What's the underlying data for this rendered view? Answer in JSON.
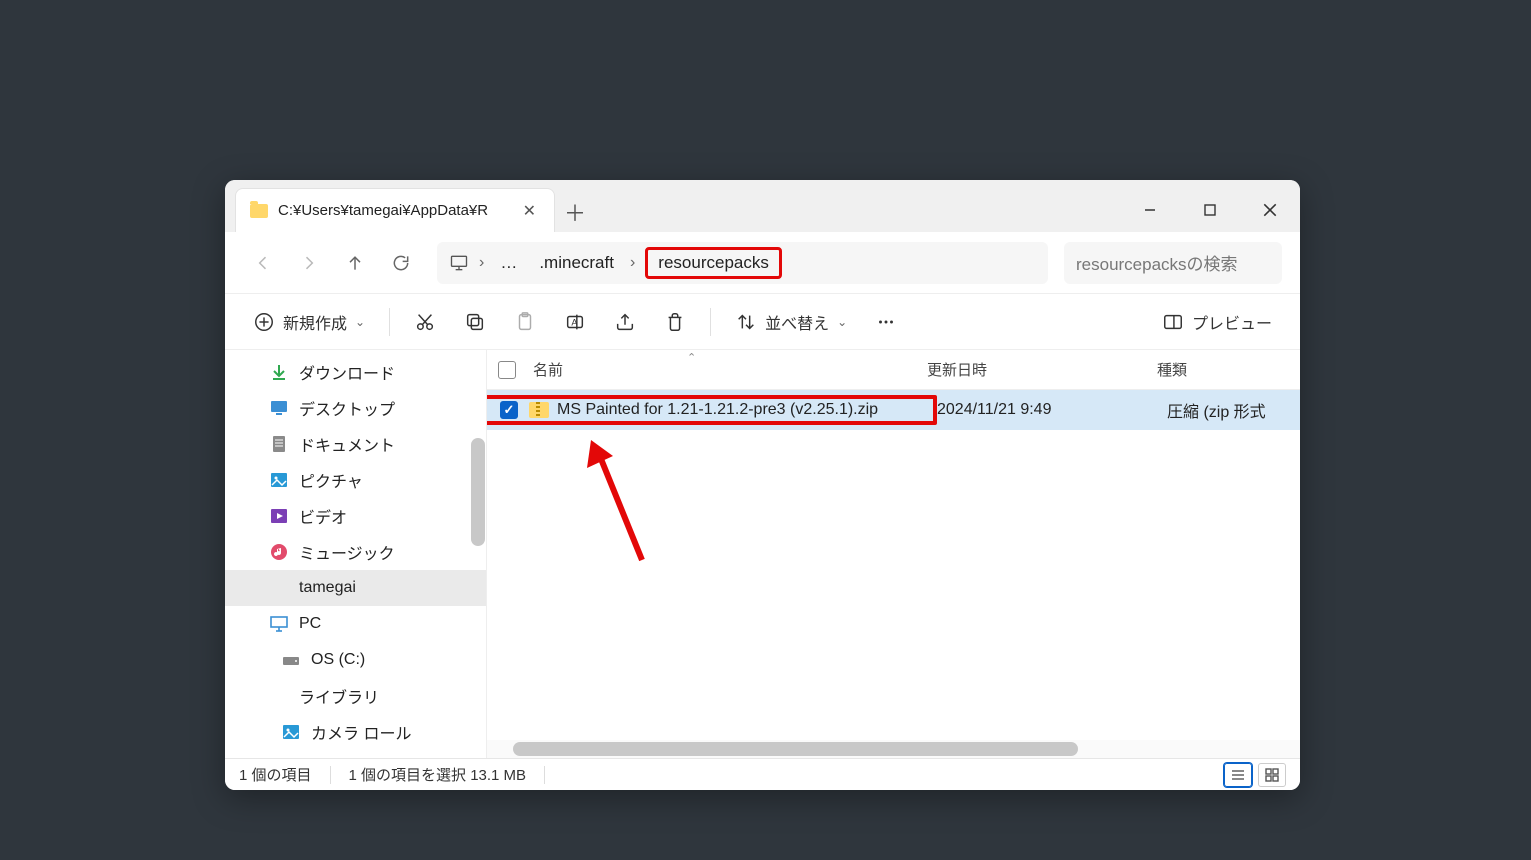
{
  "tab": {
    "title": "C:¥Users¥tamegai¥AppData¥R"
  },
  "breadcrumb": {
    "pc_icon": "pc-icon",
    "ellipsis": "…",
    "seg1": ".minecraft",
    "seg2": "resourcepacks"
  },
  "search": {
    "placeholder": "resourcepacksの検索"
  },
  "toolbar": {
    "new_label": "新規作成",
    "sort_label": "並べ替え",
    "preview_label": "プレビュー"
  },
  "sidebar": {
    "items": [
      {
        "icon": "download",
        "label": "ダウンロード"
      },
      {
        "icon": "desktop",
        "label": "デスクトップ"
      },
      {
        "icon": "document",
        "label": "ドキュメント"
      },
      {
        "icon": "picture",
        "label": "ピクチャ"
      },
      {
        "icon": "video",
        "label": "ビデオ"
      },
      {
        "icon": "music",
        "label": "ミュージック"
      },
      {
        "icon": "folder",
        "label": "tamegai",
        "selected": true
      },
      {
        "icon": "pc",
        "label": "PC"
      },
      {
        "icon": "drive",
        "label": "OS (C:)",
        "indent": true
      },
      {
        "icon": "folder",
        "label": "ライブラリ"
      },
      {
        "icon": "picture",
        "label": "カメラ ロール",
        "indent": true
      }
    ]
  },
  "columns": {
    "name": "名前",
    "date": "更新日時",
    "type": "種類"
  },
  "files": [
    {
      "name": "MS Painted for 1.21-1.21.2-pre3 (v2.25.1).zip",
      "date": "2024/11/21 9:49",
      "type": "圧縮 (zip 形式"
    }
  ],
  "status": {
    "count": "1 個の項目",
    "selected": "1 個の項目を選択 13.1 MB"
  }
}
